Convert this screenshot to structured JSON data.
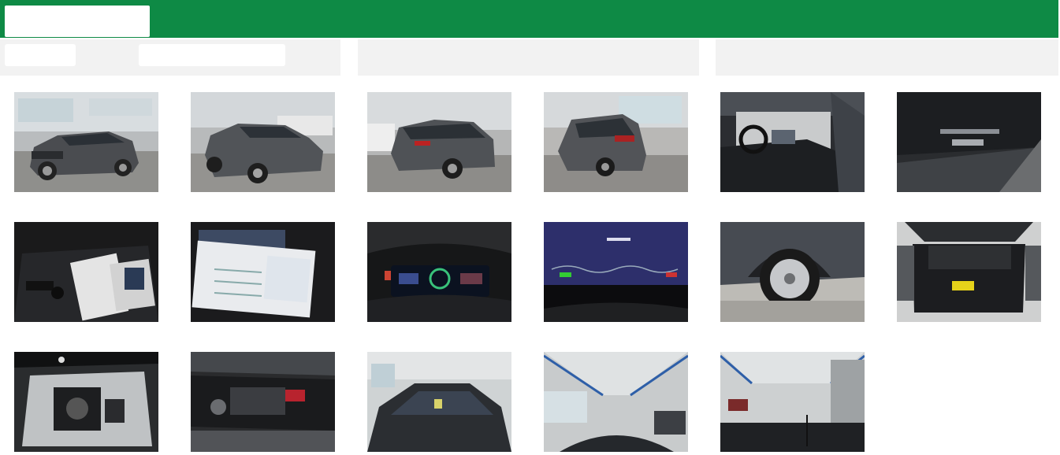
{
  "header": {
    "brand_color": "#0e8a45"
  },
  "gallery": {
    "photos": [
      {
        "name": "photo-front-left-exterior"
      },
      {
        "name": "photo-front-right-exterior"
      },
      {
        "name": "photo-rear-left-exterior"
      },
      {
        "name": "photo-rear-right-exterior"
      },
      {
        "name": "photo-driver-door-interior"
      },
      {
        "name": "photo-rear-badge"
      },
      {
        "name": "photo-keys-and-manuals"
      },
      {
        "name": "photo-service-book"
      },
      {
        "name": "photo-instrument-cluster"
      },
      {
        "name": "photo-infotainment-screen"
      },
      {
        "name": "photo-wheel"
      },
      {
        "name": "photo-open-trunk"
      },
      {
        "name": "photo-spare-wheel-well"
      },
      {
        "name": "photo-engine-bay"
      },
      {
        "name": "photo-windshield-hall"
      },
      {
        "name": "photo-roof-hall"
      },
      {
        "name": "photo-hall-view"
      }
    ]
  }
}
